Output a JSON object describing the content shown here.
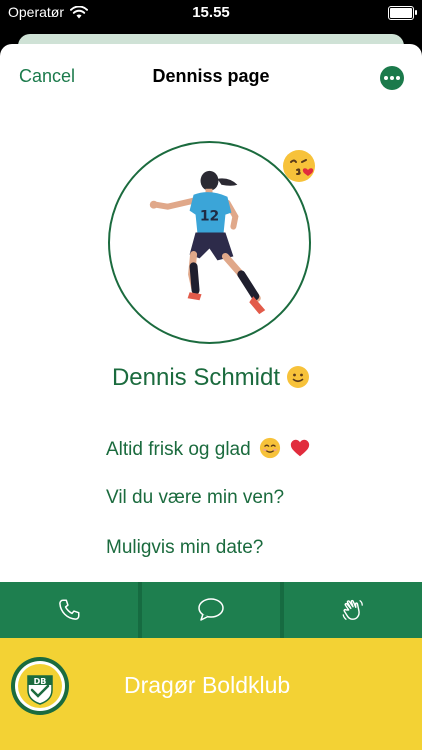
{
  "status": {
    "carrier": "Operatør",
    "time": "15.55"
  },
  "nav": {
    "cancel_label": "Cancel",
    "title": "Denniss page"
  },
  "profile": {
    "name": "Dennis Schmidt",
    "jersey_number": "12",
    "lines": [
      "Altid frisk og glad",
      "Vil du være min ven?",
      "Muligvis min date?"
    ]
  },
  "actions": [
    {
      "icon": "phone-icon"
    },
    {
      "icon": "chat-bubble-icon"
    },
    {
      "icon": "waving-hand-icon"
    }
  ],
  "club": {
    "name": "Dragør Boldklub",
    "logo_text": "DB"
  },
  "colors": {
    "accent": "#1b7a4b",
    "action_bar": "#1e7f4f",
    "club_bar": "#f3d234"
  }
}
